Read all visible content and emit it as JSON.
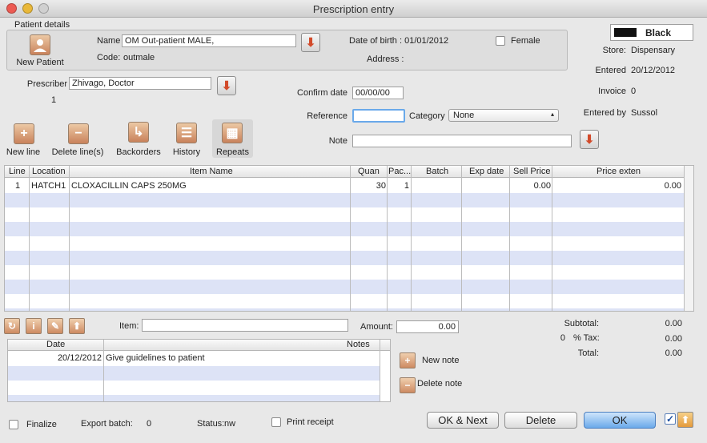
{
  "window": {
    "title": "Prescription entry"
  },
  "patient": {
    "section_label": "Patient details",
    "new_patient_label": "New Patient",
    "name_label": "Name",
    "name_value": "OM Out-patient MALE,",
    "code_label": "Code:",
    "code_value": "outmale",
    "dob_text": "Date of birth : 01/01/2012",
    "address_label": "Address :",
    "female_label": "Female"
  },
  "right_info": {
    "color_value": "Black",
    "store_label": "Store:",
    "store_value": "Dispensary",
    "entered_label": "Entered",
    "entered_value": "20/12/2012",
    "invoice_label": "Invoice",
    "invoice_value": "0",
    "entered_by_label": "Entered by",
    "entered_by_value": "Sussol"
  },
  "prescriber": {
    "label": "Prescriber",
    "value": "Zhivago, Doctor",
    "count": "1"
  },
  "form": {
    "confirm_date_label": "Confirm date",
    "confirm_date_value": "00/00/00",
    "reference_label": "Reference",
    "reference_value": "",
    "category_label": "Category",
    "category_value": "None",
    "note_label": "Note",
    "note_value": ""
  },
  "toolbar": {
    "new_line": "New line",
    "delete_lines": "Delete line(s)",
    "backorders": "Backorders",
    "history": "History",
    "repeats": "Repeats"
  },
  "table": {
    "headers": [
      "Line",
      "Location",
      "Item Name",
      "Quan",
      "Pac...",
      "Batch",
      "Exp date",
      "Sell Price",
      "Price exten"
    ],
    "rows": [
      {
        "line": "1",
        "location": "HATCH1",
        "item": "CLOXACILLIN CAPS 250MG",
        "quan": "30",
        "pack": "1",
        "batch": "",
        "exp": "",
        "sell": "0.00",
        "ext": "0.00"
      }
    ]
  },
  "bottom": {
    "item_label": "Item:",
    "item_value": "",
    "amount_label": "Amount:",
    "amount_value": "0.00",
    "subtotal_label": "Subtotal:",
    "subtotal_value": "0.00",
    "tax_rate": "0",
    "tax_label": "% Tax:",
    "tax_value": "0.00",
    "total_label": "Total:",
    "total_value": "0.00"
  },
  "notes": {
    "date_header": "Date",
    "notes_header": "Notes",
    "rows": [
      {
        "date": "20/12/2012",
        "note": "Give guidelines to patient"
      }
    ],
    "new_note": "New note",
    "delete_note": "Delete note"
  },
  "footer": {
    "finalize_label": "Finalize",
    "export_batch_label": "Export batch:",
    "export_batch_value": "0",
    "status_label": "Status:",
    "status_value": "nw",
    "print_receipt_label": "Print receipt",
    "ok_next": "OK & Next",
    "delete": "Delete",
    "ok": "OK"
  },
  "colors": {
    "accent": "#d24a2a",
    "row_alt": "#dde3f6",
    "default_button": "#6aa9ea"
  }
}
